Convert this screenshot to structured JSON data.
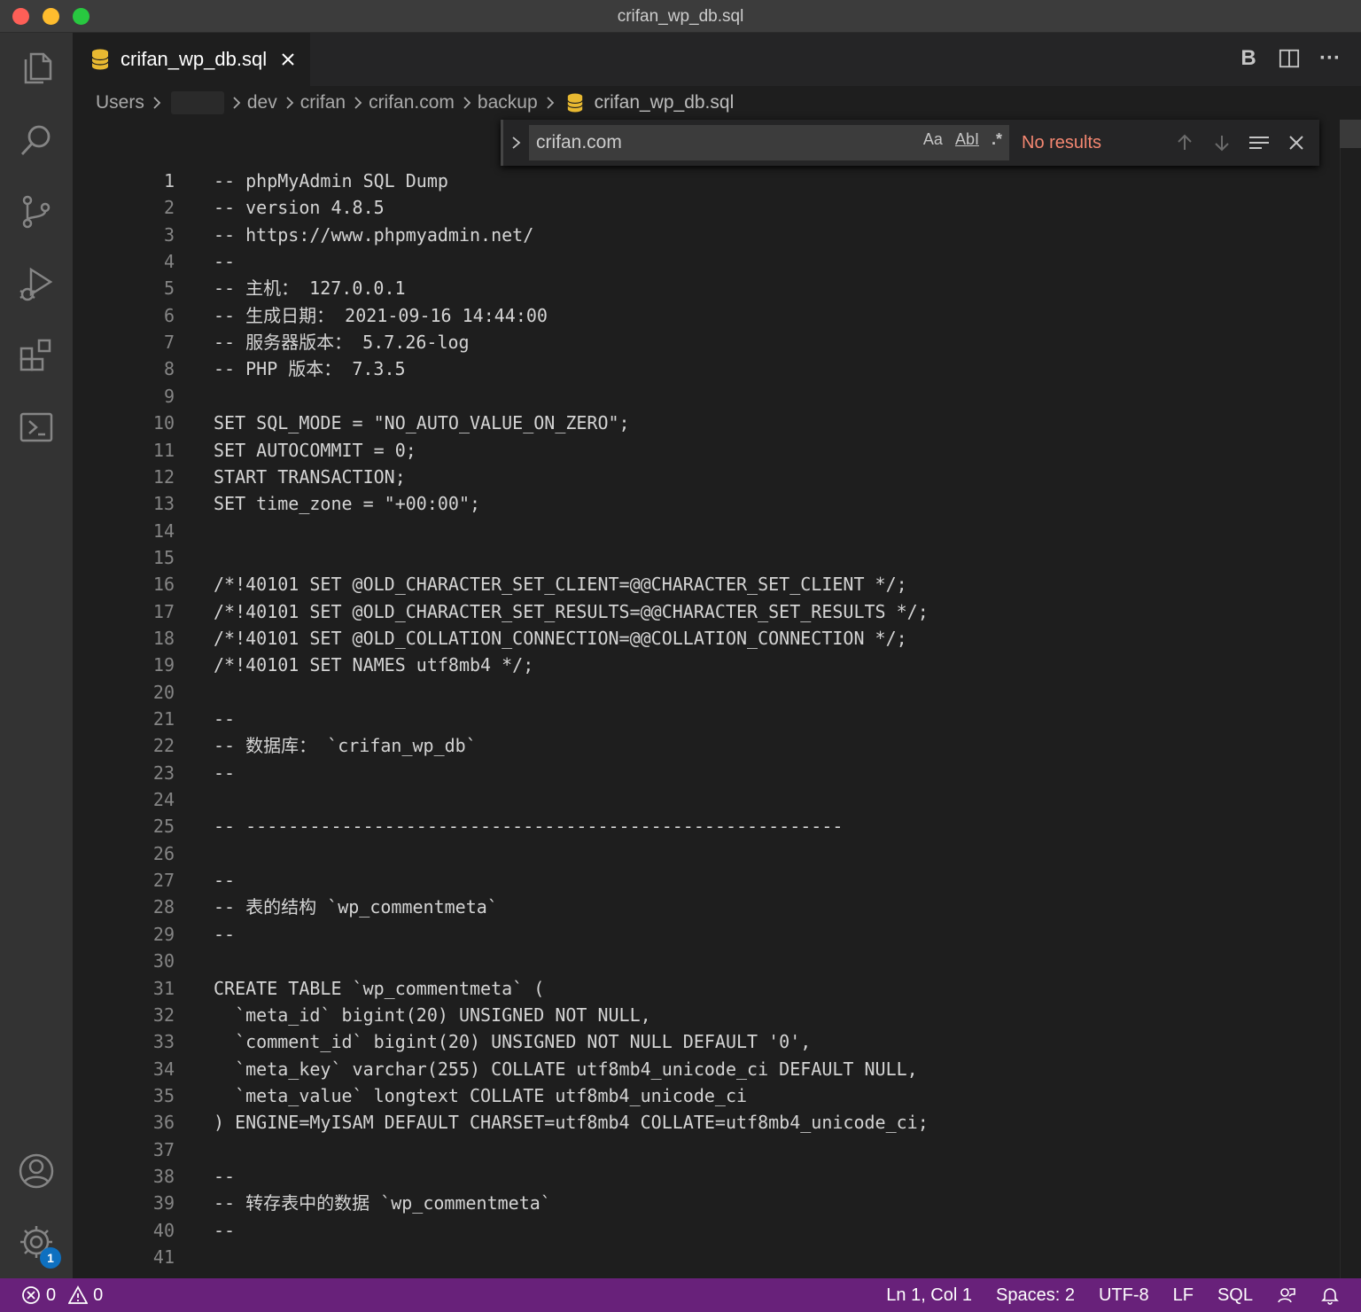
{
  "window": {
    "title": "crifan_wp_db.sql"
  },
  "activity_bar": {
    "items": [
      "explorer-icon",
      "search-icon",
      "source-control-icon",
      "run-debug-icon",
      "extensions-icon",
      "terminal-icon"
    ],
    "bottom": [
      "account-icon",
      "settings-gear-icon"
    ],
    "settings_badge": "1"
  },
  "tab": {
    "label": "crifan_wp_db.sql",
    "icon": "database-icon"
  },
  "tab_actions": {
    "bold_label": "B",
    "more_label": "···"
  },
  "breadcrumb": {
    "users": "Users",
    "dev": "dev",
    "crifan": "crifan",
    "crifan_com": "crifan.com",
    "backup": "backup",
    "file": "crifan_wp_db.sql"
  },
  "find": {
    "value": "crifan.com",
    "match_case": "Aa",
    "whole_word": "AbI",
    "regex": ".*",
    "result": "No results"
  },
  "editor": {
    "lines": [
      {
        "n": "1",
        "text": "-- phpMyAdmin SQL Dump"
      },
      {
        "n": "2",
        "text": "-- version 4.8.5"
      },
      {
        "n": "3",
        "text": "-- https://www.phpmyadmin.net/"
      },
      {
        "n": "4",
        "text": "--"
      },
      {
        "n": "5",
        "text": "-- 主机： 127.0.0.1"
      },
      {
        "n": "6",
        "text": "-- 生成日期： 2021-09-16 14:44:00"
      },
      {
        "n": "7",
        "text": "-- 服务器版本： 5.7.26-log"
      },
      {
        "n": "8",
        "text": "-- PHP 版本： 7.3.5"
      },
      {
        "n": "9",
        "text": ""
      },
      {
        "n": "10",
        "text": "SET SQL_MODE = \"NO_AUTO_VALUE_ON_ZERO\";"
      },
      {
        "n": "11",
        "text": "SET AUTOCOMMIT = 0;"
      },
      {
        "n": "12",
        "text": "START TRANSACTION;"
      },
      {
        "n": "13",
        "text": "SET time_zone = \"+00:00\";"
      },
      {
        "n": "14",
        "text": ""
      },
      {
        "n": "15",
        "text": ""
      },
      {
        "n": "16",
        "text": "/*!40101 SET @OLD_CHARACTER_SET_CLIENT=@@CHARACTER_SET_CLIENT */;"
      },
      {
        "n": "17",
        "text": "/*!40101 SET @OLD_CHARACTER_SET_RESULTS=@@CHARACTER_SET_RESULTS */;"
      },
      {
        "n": "18",
        "text": "/*!40101 SET @OLD_COLLATION_CONNECTION=@@COLLATION_CONNECTION */;"
      },
      {
        "n": "19",
        "text": "/*!40101 SET NAMES utf8mb4 */;"
      },
      {
        "n": "20",
        "text": ""
      },
      {
        "n": "21",
        "text": "--"
      },
      {
        "n": "22",
        "text": "-- 数据库： `crifan_wp_db`"
      },
      {
        "n": "23",
        "text": "--"
      },
      {
        "n": "24",
        "text": ""
      },
      {
        "n": "25",
        "text": "-- --------------------------------------------------------"
      },
      {
        "n": "26",
        "text": ""
      },
      {
        "n": "27",
        "text": "--"
      },
      {
        "n": "28",
        "text": "-- 表的结构 `wp_commentmeta`"
      },
      {
        "n": "29",
        "text": "--"
      },
      {
        "n": "30",
        "text": ""
      },
      {
        "n": "31",
        "text": "CREATE TABLE `wp_commentmeta` ("
      },
      {
        "n": "32",
        "text": "  `meta_id` bigint(20) UNSIGNED NOT NULL,"
      },
      {
        "n": "33",
        "text": "  `comment_id` bigint(20) UNSIGNED NOT NULL DEFAULT '0',"
      },
      {
        "n": "34",
        "text": "  `meta_key` varchar(255) COLLATE utf8mb4_unicode_ci DEFAULT NULL,"
      },
      {
        "n": "35",
        "text": "  `meta_value` longtext COLLATE utf8mb4_unicode_ci"
      },
      {
        "n": "36",
        "text": ") ENGINE=MyISAM DEFAULT CHARSET=utf8mb4 COLLATE=utf8mb4_unicode_ci;"
      },
      {
        "n": "37",
        "text": ""
      },
      {
        "n": "38",
        "text": "--"
      },
      {
        "n": "39",
        "text": "-- 转存表中的数据 `wp_commentmeta`"
      },
      {
        "n": "40",
        "text": "--"
      },
      {
        "n": "41",
        "text": ""
      }
    ]
  },
  "status_bar": {
    "errors": "0",
    "warnings": "0",
    "position": "Ln 1, Col 1",
    "spaces": "Spaces: 2",
    "encoding": "UTF-8",
    "eol": "LF",
    "language": "SQL"
  },
  "colors": {
    "status_bar": "#68217a",
    "editor_bg": "#1e1e1e",
    "no_results": "#f48771",
    "db_icon": "#e8b931"
  }
}
